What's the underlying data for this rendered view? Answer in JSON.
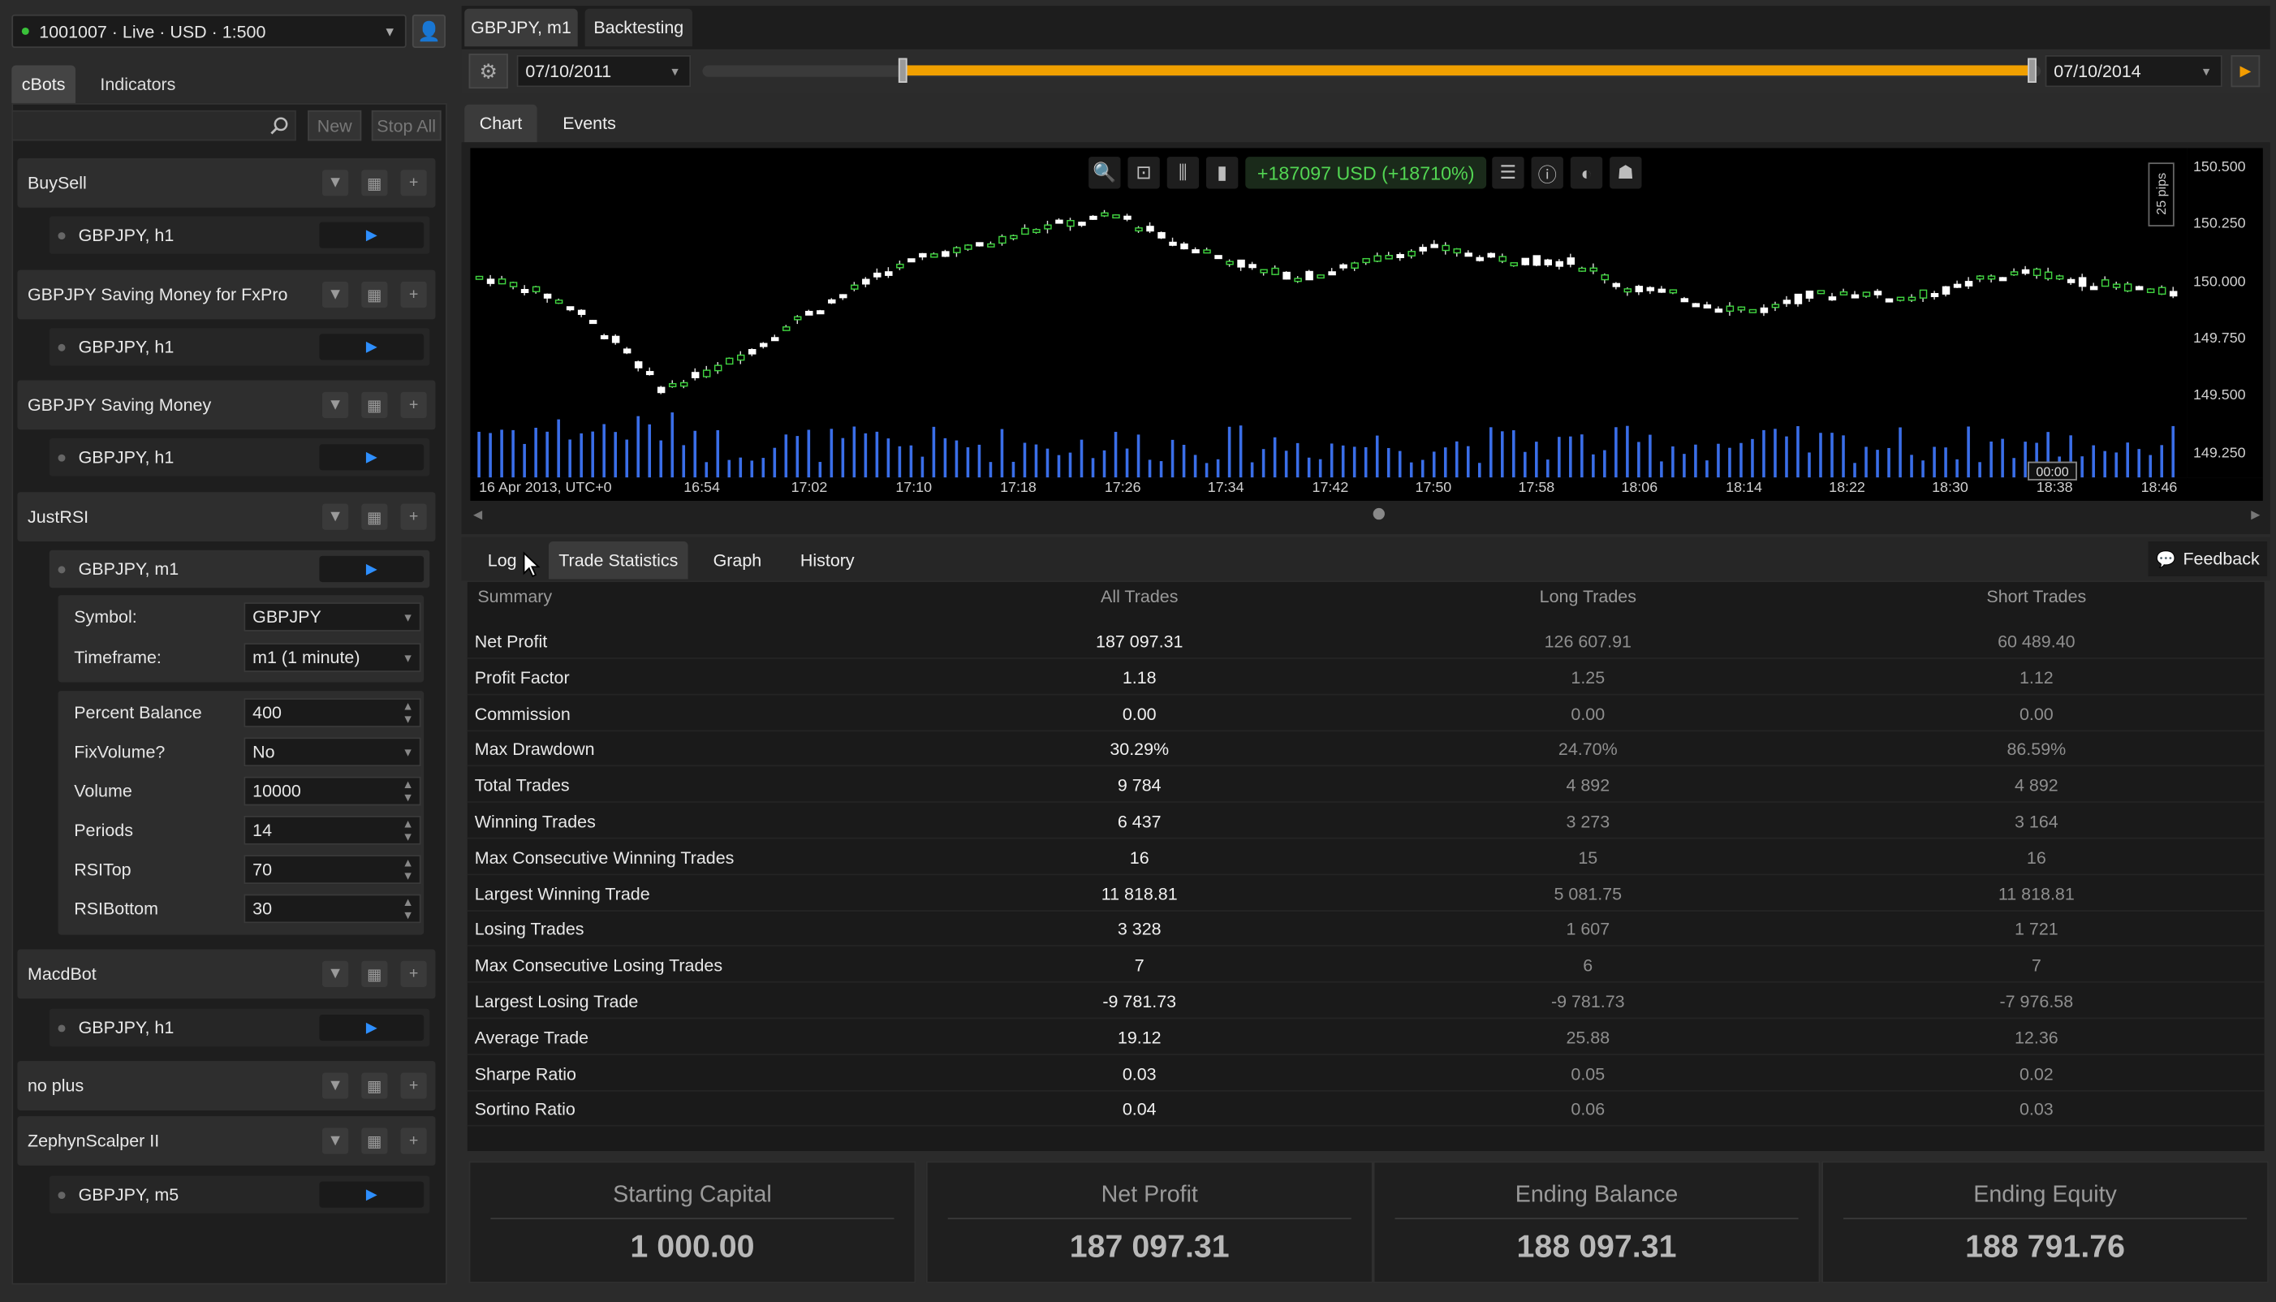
{
  "account": {
    "label": "1001007 · Live · USD · 1:500"
  },
  "left_tabs": [
    "cBots",
    "Indicators"
  ],
  "search": {
    "placeholder": ""
  },
  "buttons": {
    "new": "New",
    "stop_all": "Stop All"
  },
  "bots": [
    {
      "name": "BuySell",
      "instance": "GBPJPY, h1"
    },
    {
      "name": "GBPJPY Saving Money for FxPro",
      "instance": "GBPJPY, h1"
    },
    {
      "name": "GBPJPY Saving Money",
      "instance": "GBPJPY, h1"
    },
    {
      "name": "JustRSI",
      "instance": "GBPJPY, m1"
    },
    {
      "name": "MacdBot",
      "instance": "GBPJPY, h1"
    },
    {
      "name": "no plus",
      "instance": ""
    },
    {
      "name": "ZephynScalper II",
      "instance": "GBPJPY, m5"
    }
  ],
  "params": {
    "symbol": {
      "label": "Symbol:",
      "value": "GBPJPY"
    },
    "timeframe": {
      "label": "Timeframe:",
      "value": "m1 (1 minute)"
    },
    "rows": [
      {
        "label": "Percent Balance",
        "value": "400"
      },
      {
        "label": "FixVolume?",
        "value": "No"
      },
      {
        "label": "Volume",
        "value": "10000"
      },
      {
        "label": "Periods",
        "value": "14"
      },
      {
        "label": "RSITop",
        "value": "70"
      },
      {
        "label": "RSIBottom",
        "value": "30"
      }
    ]
  },
  "top_tabs": [
    "GBPJPY, m1",
    "Backtesting"
  ],
  "dates": {
    "start": "07/10/2011",
    "end": "07/10/2014"
  },
  "chart_tabs": [
    "Chart",
    "Events"
  ],
  "chart": {
    "profit_label": "+187097 USD (+18710%)",
    "pips_label": "25 pips",
    "cursor_label": "00:00",
    "y_ticks": [
      "150.500",
      "150.250",
      "150.000",
      "149.750",
      "149.500",
      "149.250"
    ],
    "x_ticks": [
      "16 Apr 2013, UTC+0",
      "16:54",
      "17:02",
      "17:10",
      "17:18",
      "17:26",
      "17:34",
      "17:42",
      "17:50",
      "17:58",
      "18:06",
      "18:14",
      "18:22",
      "18:30",
      "18:38",
      "18:46"
    ]
  },
  "bottom_tabs": [
    "Log",
    "Trade Statistics",
    "Graph",
    "History"
  ],
  "feedback": "Feedback",
  "table": {
    "headers": [
      "Summary",
      "All Trades",
      "Long Trades",
      "Short Trades"
    ],
    "rows": [
      [
        "Net Profit",
        "187 097.31",
        "126 607.91",
        "60 489.40"
      ],
      [
        "Profit Factor",
        "1.18",
        "1.25",
        "1.12"
      ],
      [
        "Commission",
        "0.00",
        "0.00",
        "0.00"
      ],
      [
        "Max Drawdown",
        "30.29%",
        "24.70%",
        "86.59%"
      ],
      [
        "Total Trades",
        "9 784",
        "4 892",
        "4 892"
      ],
      [
        "Winning Trades",
        "6 437",
        "3 273",
        "3 164"
      ],
      [
        "Max Consecutive Winning Trades",
        "16",
        "15",
        "16"
      ],
      [
        "Largest Winning Trade",
        "11 818.81",
        "5 081.75",
        "11 818.81"
      ],
      [
        "Losing Trades",
        "3 328",
        "1 607",
        "1 721"
      ],
      [
        "Max Consecutive Losing Trades",
        "7",
        "6",
        "7"
      ],
      [
        "Largest Losing Trade",
        "-9 781.73",
        "-9 781.73",
        "-7 976.58"
      ],
      [
        "Average Trade",
        "19.12",
        "25.88",
        "12.36"
      ],
      [
        "Sharpe Ratio",
        "0.03",
        "0.05",
        "0.02"
      ],
      [
        "Sortino Ratio",
        "0.04",
        "0.06",
        "0.03"
      ]
    ]
  },
  "cards": [
    {
      "label": "Starting Capital",
      "value": "1 000.00"
    },
    {
      "label": "Net Profit",
      "value": "187 097.31"
    },
    {
      "label": "Ending Balance",
      "value": "188 097.31"
    },
    {
      "label": "Ending Equity",
      "value": "188 791.76"
    }
  ],
  "colors": {
    "accent": "#f0a000",
    "bull": "#3fd23f",
    "volume": "#3a6ee8",
    "play": "#2e8fff"
  },
  "icons": [
    "user-icon",
    "search-icon",
    "gear-icon",
    "play-icon",
    "chevron-down-icon",
    "add-icon",
    "zoom-icon",
    "feedback-icon"
  ]
}
